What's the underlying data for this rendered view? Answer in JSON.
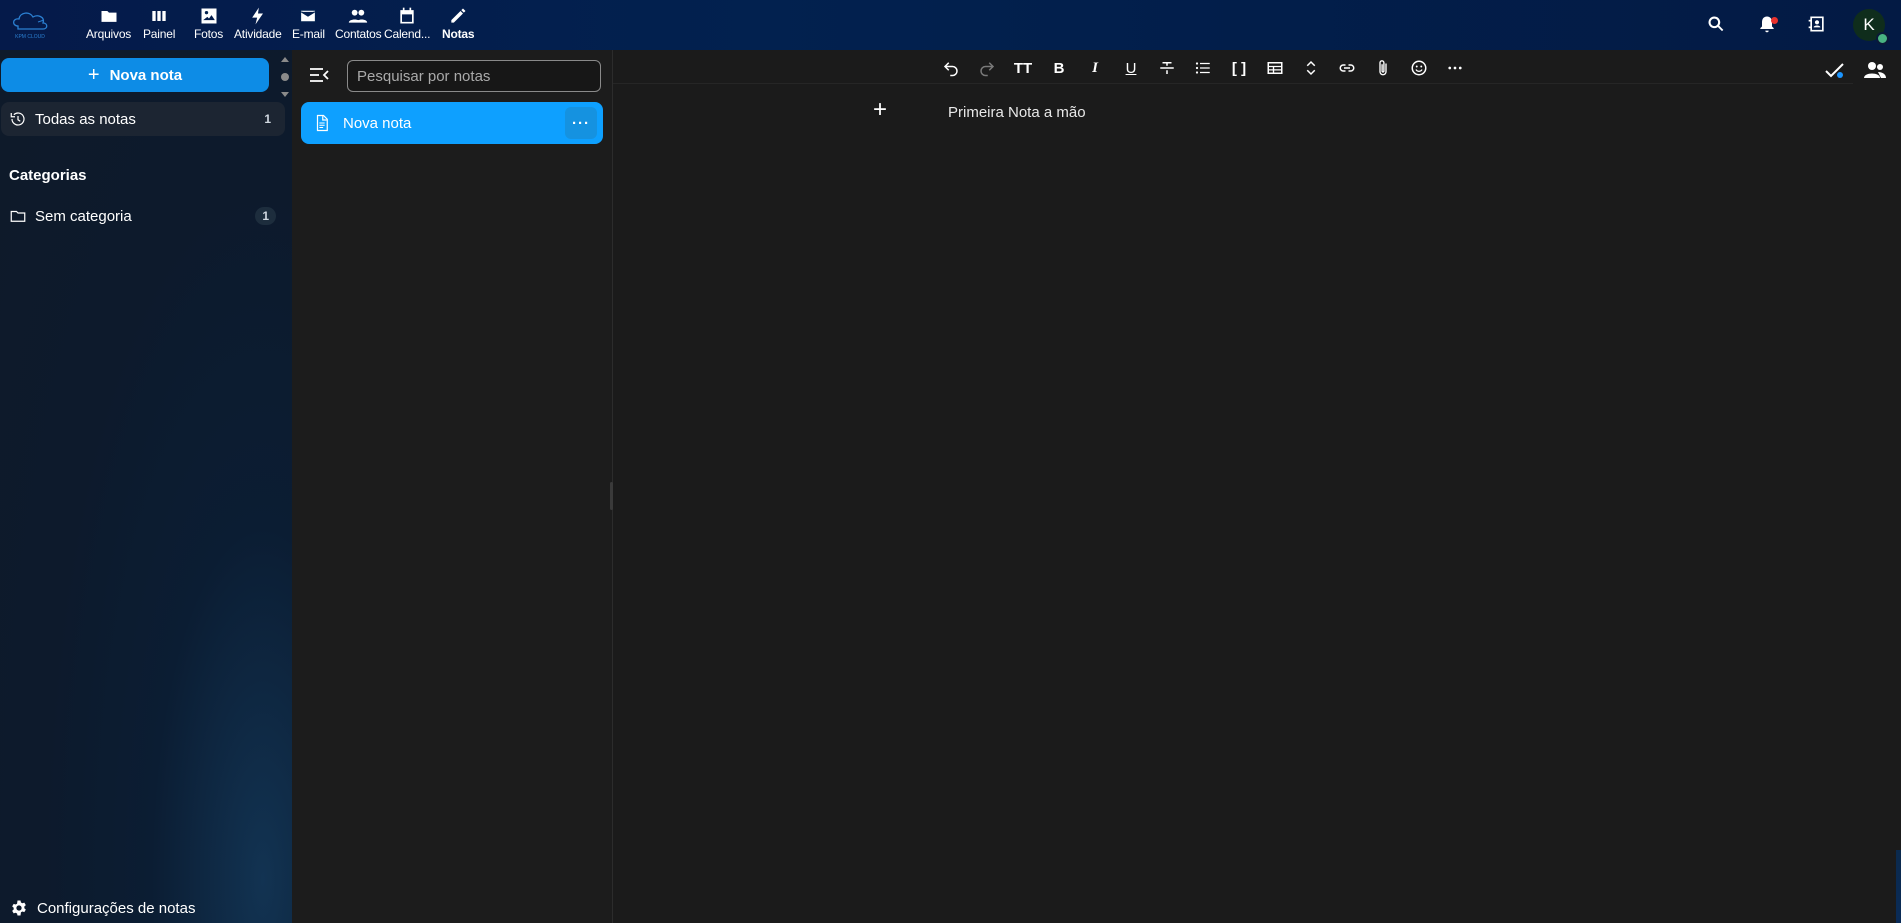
{
  "header": {
    "logo_text": "KPM CLOUD",
    "apps": [
      {
        "label": "Arquivos",
        "icon": "folder-icon"
      },
      {
        "label": "Painel",
        "icon": "dashboard-icon"
      },
      {
        "label": "Fotos",
        "icon": "image-icon"
      },
      {
        "label": "Atividade",
        "icon": "bolt-icon"
      },
      {
        "label": "E-mail",
        "icon": "mail-icon"
      },
      {
        "label": "Contatos",
        "icon": "contacts-icon"
      },
      {
        "label": "Calend...",
        "icon": "calendar-icon"
      },
      {
        "label": "Notas",
        "icon": "pencil-icon",
        "active": true
      }
    ],
    "avatar_initial": "K"
  },
  "nav": {
    "new_note_label": "Nova nota",
    "all_notes_label": "Todas as notas",
    "all_notes_count": "1",
    "categories_heading": "Categorias",
    "uncategorized_label": "Sem categoria",
    "uncategorized_count": "1",
    "settings_label": "Configurações de notas"
  },
  "list": {
    "search_placeholder": "Pesquisar por notas",
    "notes": [
      {
        "title": "Nova nota",
        "selected": true
      }
    ],
    "menu_label": "···"
  },
  "editor": {
    "toolbar_text_size_label": "TT",
    "toolbar_bold_label": "B",
    "toolbar_italic_label": "I",
    "toolbar_underline_label": "U",
    "toolbar_code_label": "[ ]",
    "content": "Primeira Nota a mão",
    "add_block_label": "+"
  },
  "colors": {
    "accent": "#0ea0ff",
    "primary_button": "#0d8ce6",
    "header_bg": "#02214f",
    "editor_bg": "#1b1b1b",
    "notification_dot": "#e9322d",
    "status_online": "#49b382"
  }
}
